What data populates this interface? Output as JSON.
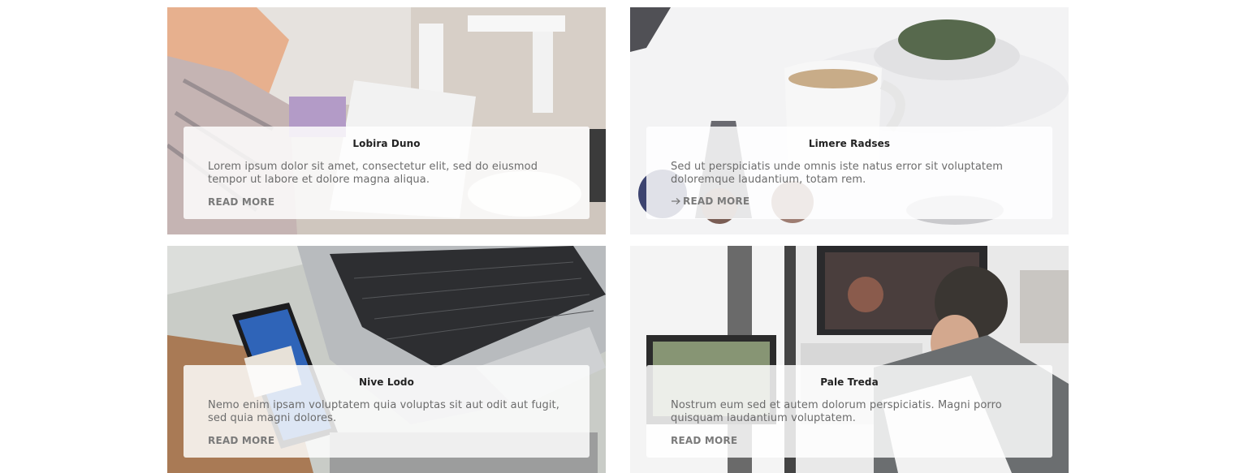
{
  "cards": [
    {
      "title": "Lobira Duno",
      "text": "Lorem ipsum dolor sit amet, consectetur elit, sed do eiusmod tempor ut labore et dolore magna aliqua.",
      "link": "READ MORE",
      "link_arrow_visible": false,
      "image": "woman-with-tablet-photo"
    },
    {
      "title": "Limere Radses",
      "text": "Sed ut perspiciatis unde omnis iste natus error sit voluptatem doloremque laudantium, totam rem.",
      "link": "READ MORE",
      "link_arrow_visible": true,
      "image": "coffee-mug-photo"
    },
    {
      "title": "Nive Lodo",
      "text": "Nemo enim ipsam voluptatem quia voluptas sit aut odit aut fugit, sed quia magni dolores.",
      "link": "READ MORE",
      "link_arrow_visible": false,
      "image": "laptop-and-phone-photo"
    },
    {
      "title": "Pale Treda",
      "text": "Nostrum eum sed et autem dolorum perspiciatis. Magni porro quisquam laudantium voluptatem.",
      "link": "READ MORE",
      "link_arrow_visible": false,
      "image": "man-at-computer-photo"
    }
  ]
}
